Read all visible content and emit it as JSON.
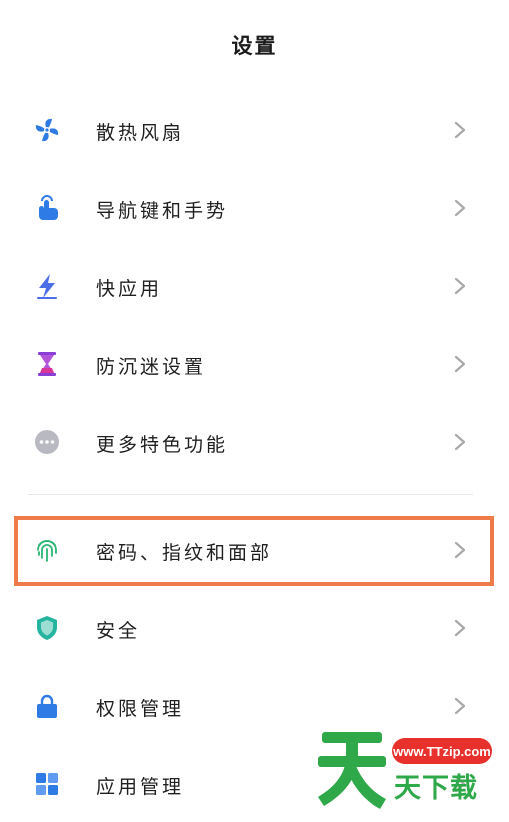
{
  "header": {
    "title": "设置"
  },
  "settings": {
    "items": [
      {
        "label": "散热风扇"
      },
      {
        "label": "导航键和手势"
      },
      {
        "label": "快应用"
      },
      {
        "label": "防沉迷设置"
      },
      {
        "label": "更多特色功能"
      },
      {
        "label": "密码、指纹和面部"
      },
      {
        "label": "安全"
      },
      {
        "label": "权限管理"
      },
      {
        "label": "应用管理"
      }
    ]
  },
  "watermark": {
    "url": "www.TTzip.com",
    "big_char": "天",
    "text": "天下载"
  },
  "colors": {
    "accent_blue": "#2f7be5",
    "highlight": "#ef7a4a",
    "watermark_green": "#2fa84a",
    "watermark_red": "#e8312d"
  },
  "icons": [
    "fan-icon",
    "navigation-gesture-icon",
    "quick-app-icon",
    "anti-addiction-icon",
    "more-features-icon",
    "fingerprint-icon",
    "security-shield-icon",
    "lock-icon",
    "app-grid-icon"
  ]
}
